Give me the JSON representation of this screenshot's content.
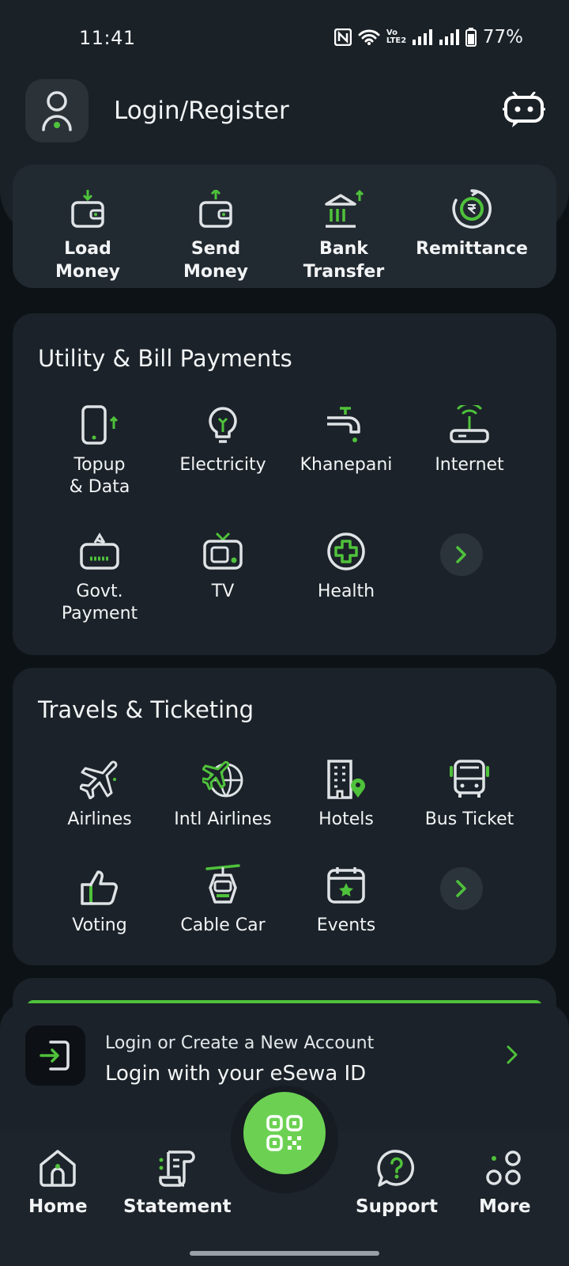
{
  "status_bar": {
    "time": "11:41",
    "battery": "77%",
    "network_label": "Vo LTE2"
  },
  "header": {
    "title": "Login/Register"
  },
  "quick_actions": [
    {
      "label_line1": "Load",
      "label_line2": "Money"
    },
    {
      "label_line1": "Send",
      "label_line2": "Money"
    },
    {
      "label_line1": "Bank",
      "label_line2": "Transfer"
    },
    {
      "label_line1": "Remittance",
      "label_line2": ""
    }
  ],
  "utility": {
    "title": "Utility & Bill Payments",
    "items": [
      {
        "line1": "Topup",
        "line2": "& Data"
      },
      {
        "line1": "Electricity",
        "line2": ""
      },
      {
        "line1": "Khanepani",
        "line2": ""
      },
      {
        "line1": "Internet",
        "line2": ""
      },
      {
        "line1": "Govt.",
        "line2": "Payment"
      },
      {
        "line1": "TV",
        "line2": ""
      },
      {
        "line1": "Health",
        "line2": ""
      }
    ]
  },
  "travels": {
    "title": "Travels & Ticketing",
    "items": [
      {
        "label": "Airlines"
      },
      {
        "label": "Intl Airlines"
      },
      {
        "label": "Hotels"
      },
      {
        "label": "Bus Ticket"
      },
      {
        "label": "Voting"
      },
      {
        "label": "Cable Car"
      },
      {
        "label": "Events"
      }
    ]
  },
  "login_banner": {
    "subtitle": "Login or Create a New Account",
    "title": "Login with your eSewa ID"
  },
  "bottom_nav": {
    "home": "Home",
    "statement": "Statement",
    "support": "Support",
    "more": "More"
  },
  "colors": {
    "accent": "#4fc23b",
    "qr_button": "#6cd153",
    "background": "#0d1216",
    "card": "#1b2229"
  }
}
